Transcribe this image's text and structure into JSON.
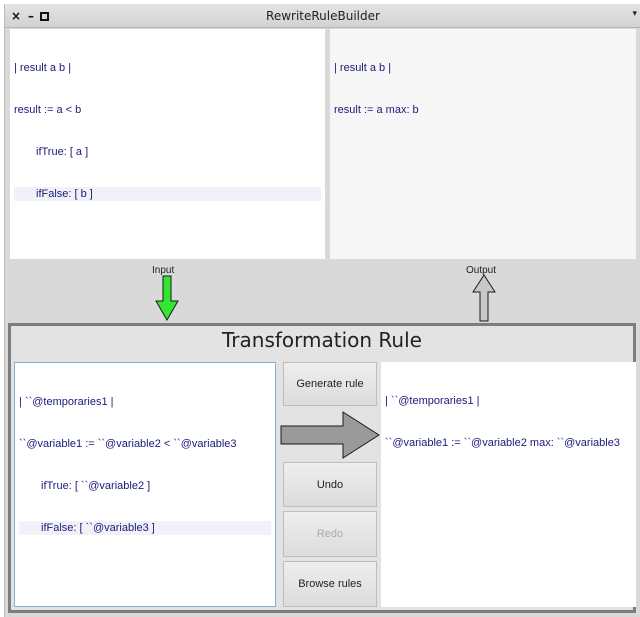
{
  "window": {
    "title": "RewriteRuleBuilder",
    "controls": {
      "close": "×",
      "minimize": "–",
      "menu": "▾"
    }
  },
  "input_pane": {
    "lines": [
      "| result a b |",
      "result := a < b",
      "ifTrue: [ a ]",
      "ifFalse: [ b ]"
    ]
  },
  "output_pane": {
    "lines": [
      "| result a b |",
      "result := a max: b"
    ]
  },
  "labels": {
    "input": "Input",
    "output": "Output"
  },
  "rule": {
    "title": "Transformation Rule",
    "lhs_lines": [
      "| ``@temporaries1 |",
      "``@variable1 := ``@variable2 < ``@variable3",
      "ifTrue: [ ``@variable2 ]",
      "ifFalse: [ ``@variable3 ]"
    ],
    "rhs_lines": [
      "| ``@temporaries1 |",
      "``@variable1 := ``@variable2 max: ``@variable3"
    ]
  },
  "buttons": {
    "generate": "Generate rule",
    "undo": "Undo",
    "redo": "Redo",
    "browse": "Browse rules"
  },
  "colors": {
    "input_arrow": "#33e633",
    "output_arrow": "#bdbdbd",
    "code_text": "#1a1a7a"
  }
}
